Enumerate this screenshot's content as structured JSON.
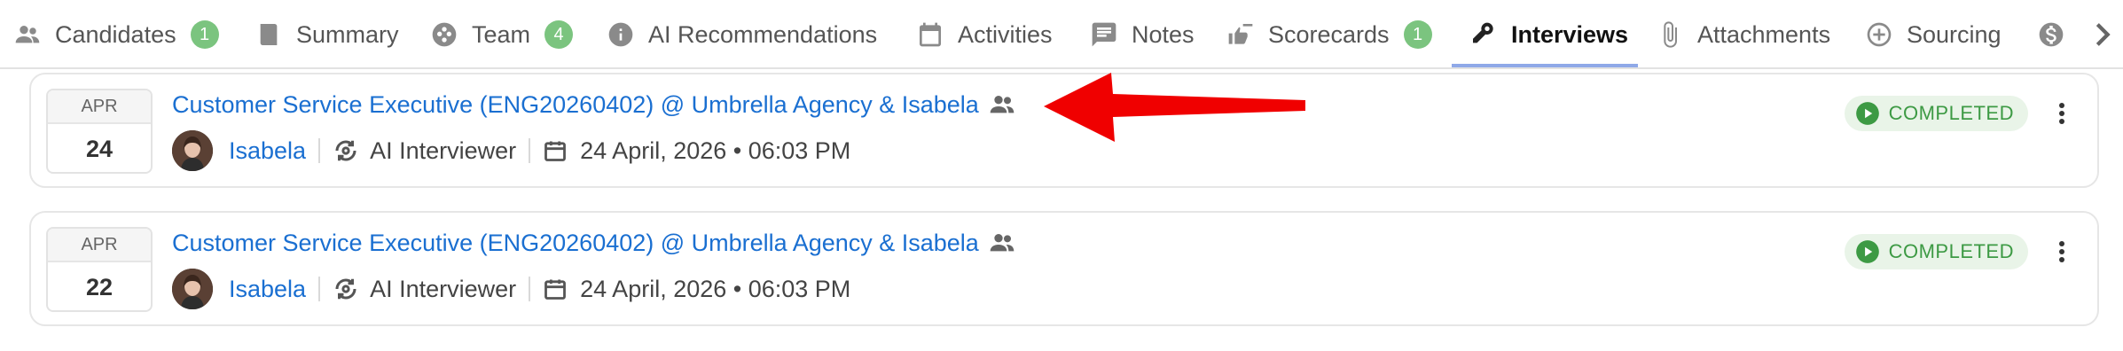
{
  "tabs": [
    {
      "label": "Candidates",
      "badge": "1",
      "icon": "people-icon"
    },
    {
      "label": "Summary",
      "badge": null,
      "icon": "book-icon"
    },
    {
      "label": "Team",
      "badge": "4",
      "icon": "team-icon"
    },
    {
      "label": "AI Recommendations",
      "badge": null,
      "icon": "info-icon"
    },
    {
      "label": "Activities",
      "badge": null,
      "icon": "calendar-icon"
    },
    {
      "label": "Notes",
      "badge": null,
      "icon": "chat-icon"
    },
    {
      "label": "Scorecards",
      "badge": "1",
      "icon": "thumbs-icon"
    },
    {
      "label": "Interviews",
      "badge": null,
      "icon": "microphone-icon",
      "active": true
    },
    {
      "label": "Attachments",
      "badge": null,
      "icon": "paperclip-icon"
    },
    {
      "label": "Sourcing",
      "badge": null,
      "icon": "plus-circle-icon"
    }
  ],
  "interviews": [
    {
      "month": "APR",
      "day": "24",
      "title": "Customer Service Executive (ENG20260402) @ Umbrella Agency & Isabela",
      "person": "Isabela",
      "interviewer": "AI Interviewer",
      "datetime": "24 April, 2026 • 06:03 PM",
      "status": "COMPLETED"
    },
    {
      "month": "APR",
      "day": "22",
      "title": "Customer Service Executive (ENG20260402) @ Umbrella Agency & Isabela",
      "person": "Isabela",
      "interviewer": "AI Interviewer",
      "datetime": "24 April, 2026 • 06:03 PM",
      "status": "COMPLETED"
    }
  ],
  "colors": {
    "link": "#1a6fd1",
    "badge": "#7bc47f",
    "status_text": "#3d9a44",
    "status_bg": "#e9f4e8",
    "annotation_arrow": "#f00000",
    "active_tab_underline": "#8fa9e8"
  }
}
